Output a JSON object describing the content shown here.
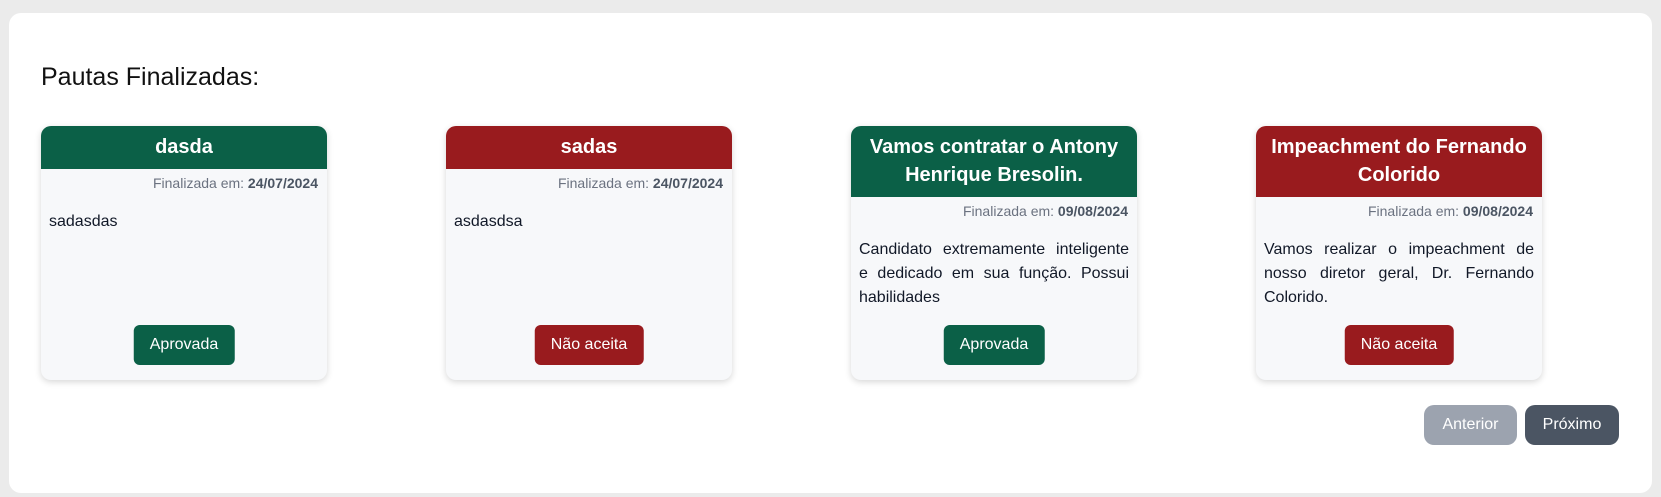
{
  "section": {
    "title": "Pautas Finalizadas:"
  },
  "cards": [
    {
      "title": "dasda",
      "finalized_label": "Finalizada em:",
      "finalized_date": "24/07/2024",
      "description": "sadasdas",
      "status": "Aprovada",
      "color": "#0b6047"
    },
    {
      "title": "sadas",
      "finalized_label": "Finalizada em:",
      "finalized_date": "24/07/2024",
      "description": "asdasdsa",
      "status": "Não aceita",
      "color": "#991b1e"
    },
    {
      "title": "Vamos contratar o Antony Henrique Bresolin.",
      "finalized_label": "Finalizada em:",
      "finalized_date": "09/08/2024",
      "description": "Candidato extremamente inteligente e dedicado em sua função. Possui habilidades",
      "status": "Aprovada",
      "color": "#0b6047"
    },
    {
      "title": "Impeachment do Fernando Colorido",
      "finalized_label": "Finalizada em:",
      "finalized_date": "09/08/2024",
      "description": "Vamos realizar o impeachment de nosso diretor geral, Dr. Fernando Colorido.",
      "status": "Não aceita",
      "color": "#991b1e"
    }
  ],
  "pagination": {
    "previous": "Anterior",
    "next": "Próximo"
  },
  "colors": {
    "approved": "#0b6047",
    "rejected": "#991b1e",
    "pager_disabled": "#9ca3af",
    "pager_active": "#4b5563"
  }
}
